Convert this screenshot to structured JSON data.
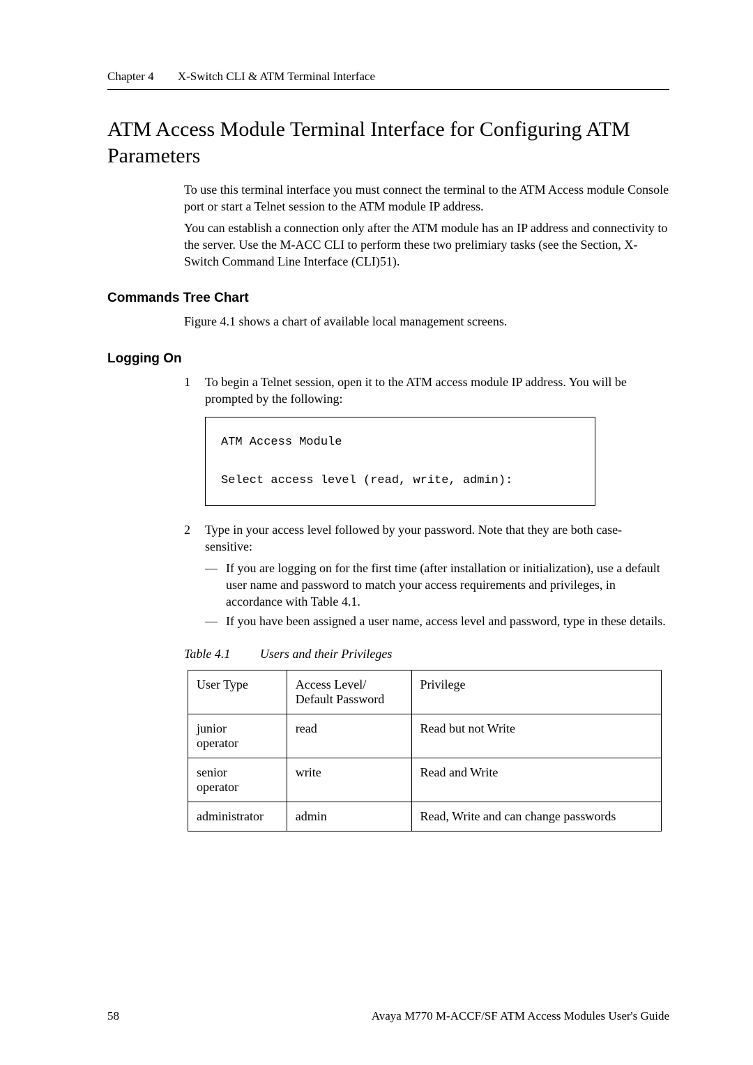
{
  "running_head": {
    "chapter": "Chapter 4",
    "title": "X-Switch CLI & ATM Terminal Interface"
  },
  "section_title": "ATM Access Module Terminal Interface for Configuring ATM Parameters",
  "intro": {
    "p1": "To use this terminal interface you must connect the terminal to the ATM Access module Console port or start a Telnet session to the ATM module IP address.",
    "p2": "You can establish a connection only after the ATM module has an IP address and connectivity to the server. Use the M-ACC CLI to perform these two prelimiary tasks (see the Section, X-Switch Command Line Interface (CLI)51)."
  },
  "commands_tree": {
    "heading": "Commands Tree Chart",
    "text": "Figure 4.1 shows a chart of available local management screens."
  },
  "logging_on": {
    "heading": "Logging On",
    "step1_num": "1",
    "step1_text": "To begin a Telnet session, open it to the ATM access module IP address. You will be prompted by the following:",
    "code": "ATM Access Module\n\nSelect access level (read, write, admin):",
    "step2_num": "2",
    "step2_text": "Type in your access level followed by your password. Note that they are both case-sensitive:",
    "bullet1": "If you are logging on for the first time (after installation or initialization), use a default user name and password to match your access requirements and privileges, in accordance with Table 4.1.",
    "bullet2": "If you have been assigned a user name, access level and password, type in these details."
  },
  "table": {
    "caption_num": "Table 4.1",
    "caption_text": "Users and their Privileges",
    "headers": {
      "c1": "User Type",
      "c2_l1": "Access Level/",
      "c2_l2": "Default Password",
      "c3": "Privilege"
    },
    "rows": [
      {
        "c1_l1": "junior",
        "c1_l2": "operator",
        "c2": "read",
        "c3": "Read but not Write"
      },
      {
        "c1_l1": "senior",
        "c1_l2": "operator",
        "c2": "write",
        "c3": "Read and Write"
      },
      {
        "c1_l1": "administrator",
        "c1_l2": "",
        "c2": "admin",
        "c3": "Read, Write and can change passwords"
      }
    ]
  },
  "footer": {
    "page": "58",
    "doc": "Avaya M770 M-ACCF/SF ATM Access Modules User's Guide"
  },
  "chart_data": {
    "type": "table",
    "title": "Users and their Privileges",
    "columns": [
      "User Type",
      "Access Level/Default Password",
      "Privilege"
    ],
    "rows": [
      [
        "junior operator",
        "read",
        "Read but not Write"
      ],
      [
        "senior operator",
        "write",
        "Read and Write"
      ],
      [
        "administrator",
        "admin",
        "Read, Write and can change passwords"
      ]
    ]
  }
}
